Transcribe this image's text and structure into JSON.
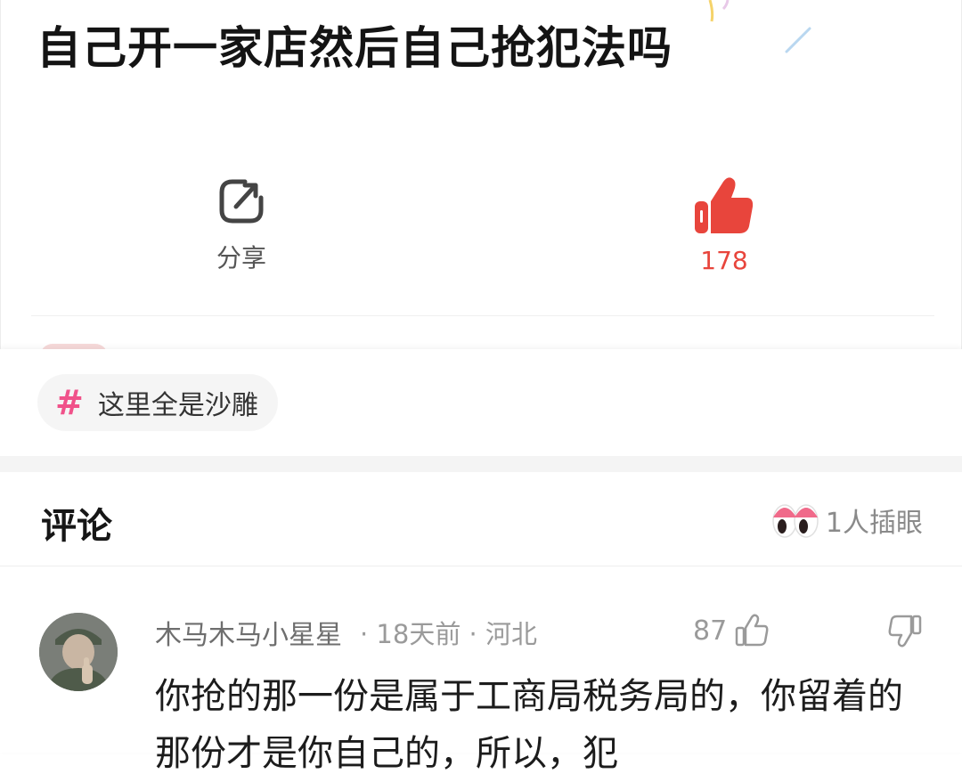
{
  "post": {
    "title": "自己开一家店然后自己抢犯法吗",
    "share_label": "分享",
    "like_count": "178"
  },
  "topic": {
    "symbol": "#",
    "label": "这里全是沙雕"
  },
  "comments_section": {
    "title": "评论",
    "peek_count_text": "1人插眼"
  },
  "comment": {
    "author": "木马木马小星星",
    "meta": "· 18天前 · 河北",
    "like_count": "87",
    "text": "你抢的那一份是属于工商局税务局的，你留着的那份才是你自己的，所以，犯"
  },
  "colors": {
    "like_red": "#e8453c",
    "topic_pink": "#f0528a",
    "muted_text": "#9a9a9a"
  },
  "icons": [
    "share-icon",
    "thumb-up-filled-icon",
    "hashtag-icon",
    "eyes-icon",
    "thumb-up-outline-icon",
    "thumb-down-outline-icon"
  ]
}
